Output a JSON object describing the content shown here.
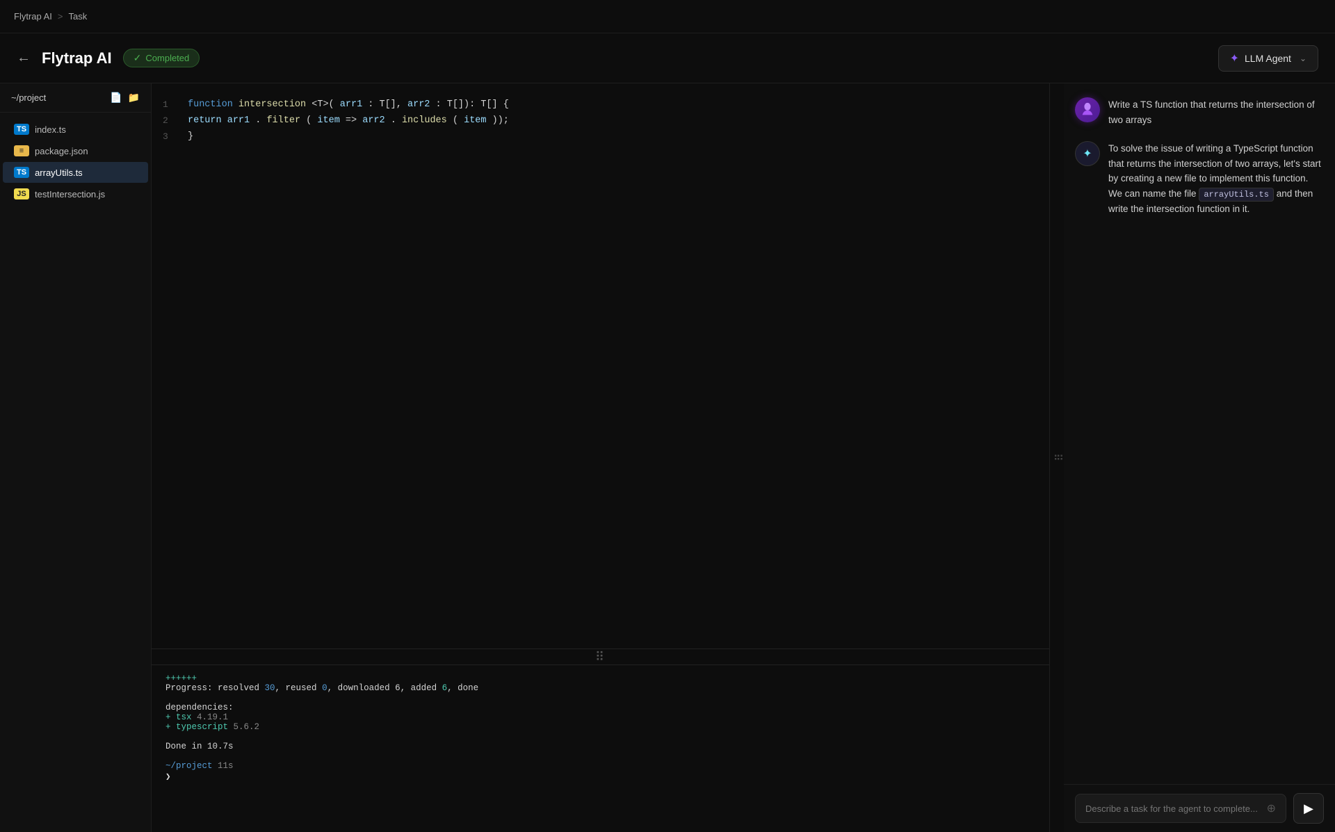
{
  "topbar": {
    "brand": "Flytrap AI",
    "separator": ">",
    "page": "Task"
  },
  "header": {
    "back_label": "←",
    "title": "Flytrap AI",
    "status": "Completed",
    "llm_label": "LLM Agent"
  },
  "sidebar": {
    "project_name": "~/project",
    "files": [
      {
        "name": "index.ts",
        "type": "ts",
        "icon": "TS",
        "active": false
      },
      {
        "name": "package.json",
        "type": "json",
        "icon": "≡",
        "active": false
      },
      {
        "name": "arrayUtils.ts",
        "type": "ts",
        "icon": "TS",
        "active": true
      },
      {
        "name": "testIntersection.js",
        "type": "js",
        "icon": "JS",
        "active": false
      }
    ]
  },
  "editor": {
    "lines": [
      {
        "num": "1",
        "code": "function intersection<T>(arr1: T[], arr2: T[]): T[] {"
      },
      {
        "num": "2",
        "code": "    return arr1.filter(item => arr2.includes(item));"
      },
      {
        "num": "3",
        "code": "}"
      }
    ]
  },
  "terminal": {
    "lines": [
      {
        "text": "++++++",
        "color": "plus"
      },
      {
        "text": "Progress: resolved ",
        "color": "white",
        "parts": [
          {
            "text": "30",
            "color": "blue"
          },
          {
            "text": ", reused ",
            "color": "white"
          },
          {
            "text": "0",
            "color": "blue"
          },
          {
            "text": ", downloaded 6, added ",
            "color": "white"
          },
          {
            "text": "6",
            "color": "green"
          },
          {
            "text": ", done",
            "color": "white"
          }
        ]
      },
      {
        "text": ""
      },
      {
        "text": "dependencies:",
        "color": "white"
      },
      {
        "text": "+ tsx 4.19.1",
        "parts": [
          {
            "text": "+ tsx ",
            "color": "green"
          },
          {
            "text": "4.19.1",
            "color": "ver"
          }
        ]
      },
      {
        "text": "+ typescript 5.6.2",
        "parts": [
          {
            "text": "+ typescript ",
            "color": "green"
          },
          {
            "text": "5.6.2",
            "color": "ver"
          }
        ]
      },
      {
        "text": ""
      },
      {
        "text": "Done in 10.7s",
        "color": "white"
      },
      {
        "text": ""
      },
      {
        "text": "~/project 11s",
        "color": "path"
      },
      {
        "text": "❯",
        "color": "prompt"
      }
    ]
  },
  "chat": {
    "messages": [
      {
        "role": "user",
        "avatar_icon": "🪲",
        "text": "Write a TS function that returns the intersection of two arrays"
      },
      {
        "role": "agent",
        "avatar_icon": "✦",
        "text_before": "To solve the issue of writing a TypeScript function that returns the intersection of two arrays, let's start by creating a new file to implement this function. We can name the file ",
        "inline_code": "arrayUtils.ts",
        "text_after": " and then write the intersection function in it."
      }
    ],
    "input_placeholder": "Describe a task for the agent to complete...",
    "send_icon": "▶"
  }
}
